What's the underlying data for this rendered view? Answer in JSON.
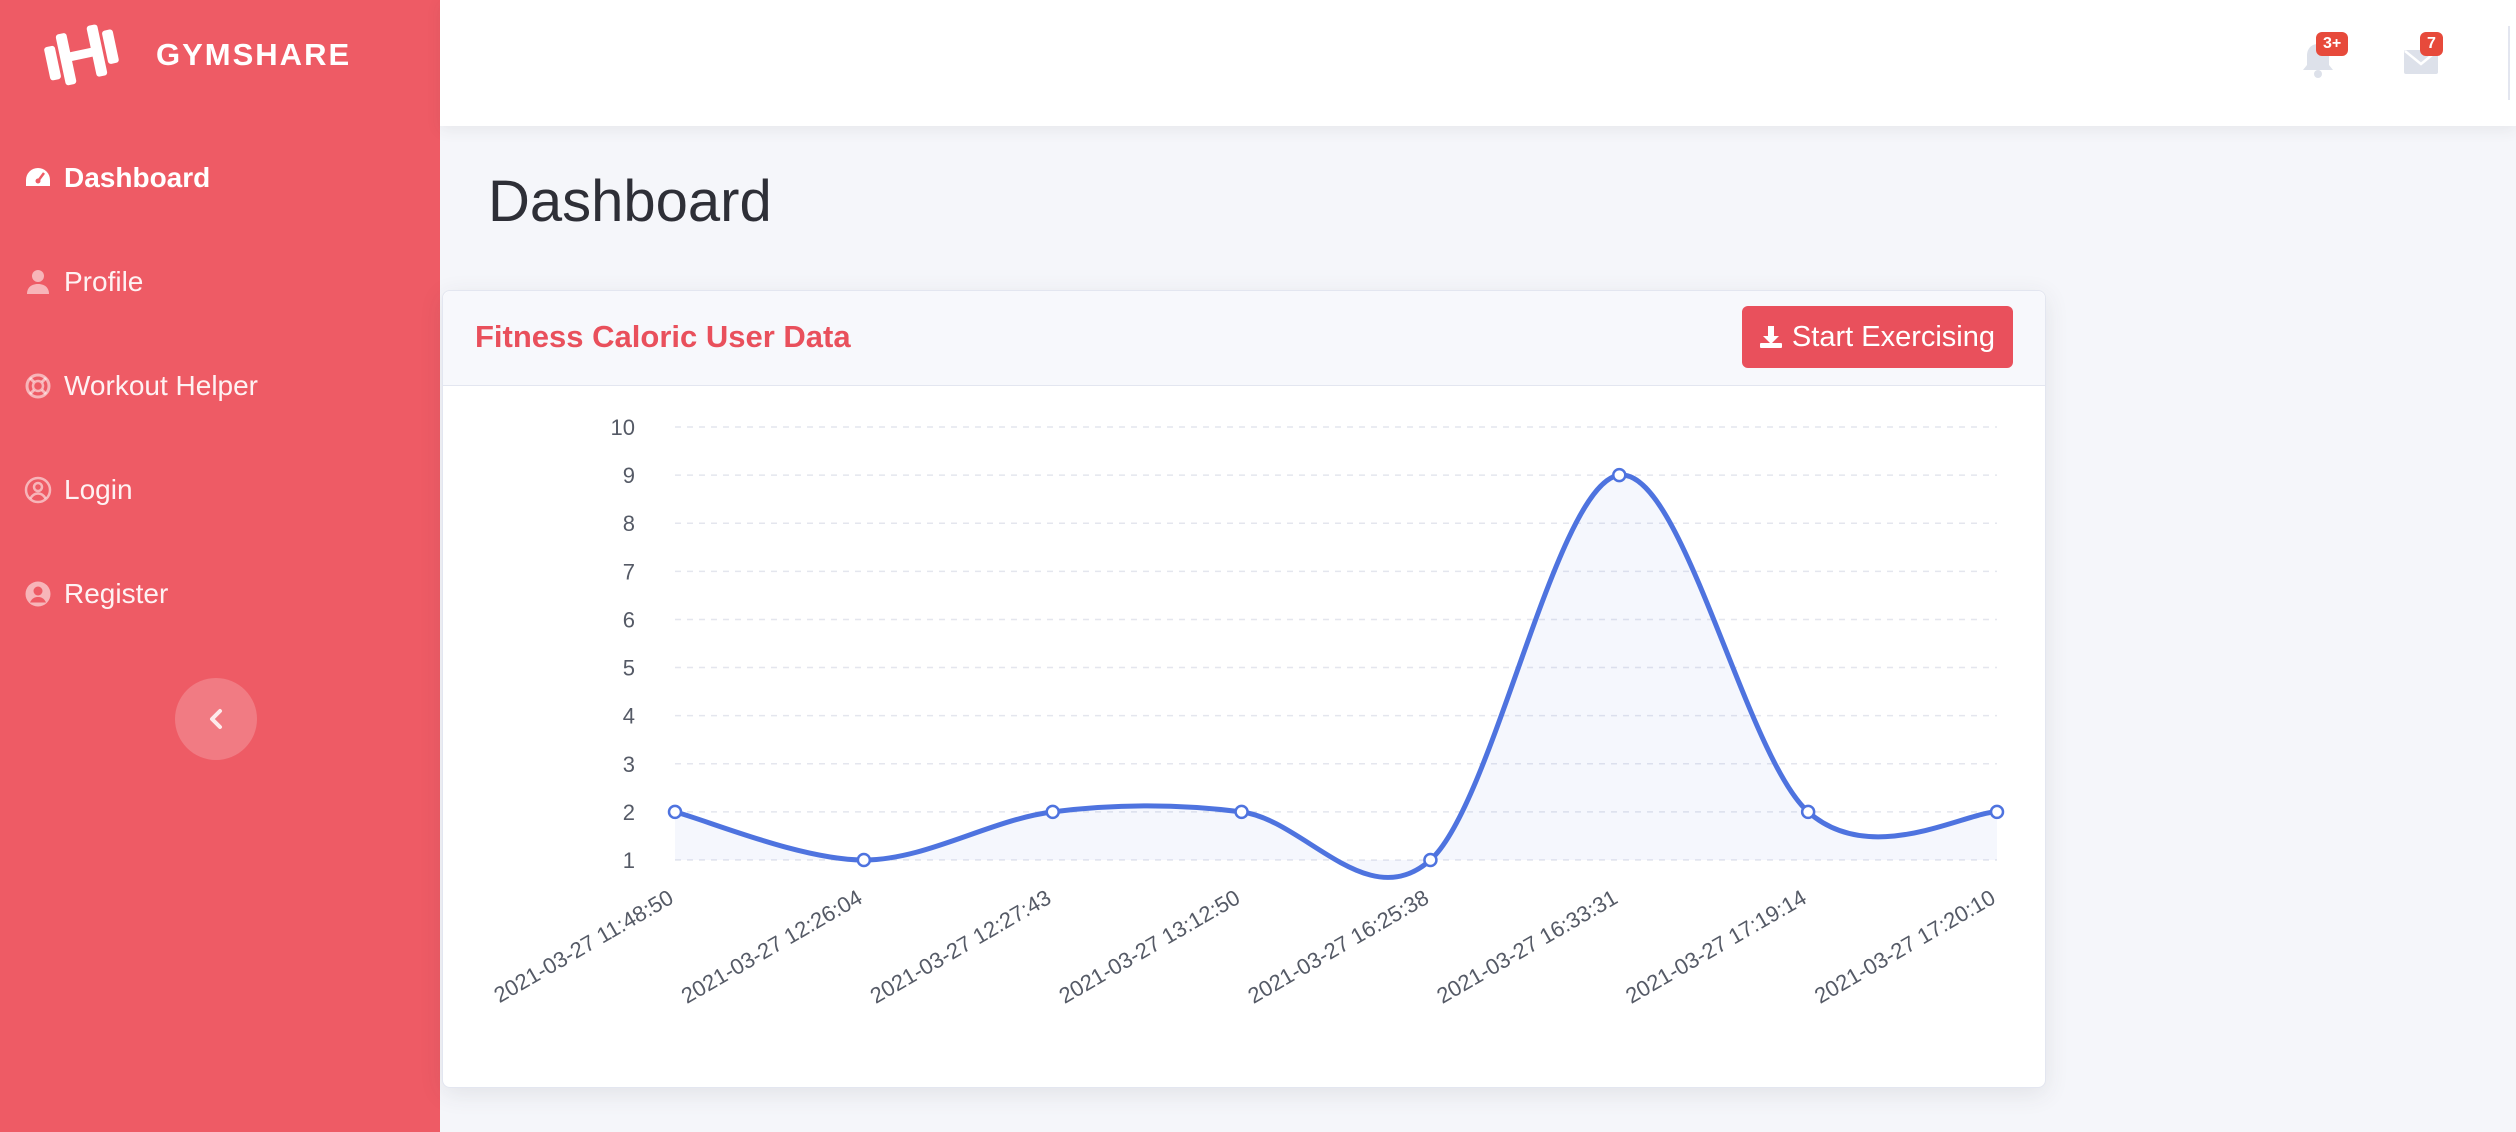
{
  "brand": {
    "name": "GYMSHARE"
  },
  "sidebar": {
    "items": [
      {
        "label": "Dashboard",
        "icon": "tachometer-icon",
        "active": true
      },
      {
        "label": "Profile",
        "icon": "user-icon",
        "active": false
      },
      {
        "label": "Workout Helper",
        "icon": "life-ring-icon",
        "active": false
      },
      {
        "label": "Login",
        "icon": "user-circle-icon",
        "active": false
      },
      {
        "label": "Register",
        "icon": "user-circle-solid-icon",
        "active": false
      }
    ],
    "collapse_icon": "chevron-left-icon"
  },
  "topbar": {
    "alerts": {
      "icon": "bell-icon",
      "badge": "3+"
    },
    "messages": {
      "icon": "envelope-icon",
      "badge": "7"
    }
  },
  "page": {
    "title": "Dashboard"
  },
  "card": {
    "title": "Fitness Caloric User Data",
    "button_label": "Start Exercising",
    "button_icon": "download-icon"
  },
  "colors": {
    "sidebar": "#ee5b65",
    "accent": "#e9505c",
    "line": "#4e73df",
    "badge": "#e74a3b"
  },
  "chart_data": {
    "type": "line",
    "smooth": true,
    "filled": true,
    "grid": true,
    "categories": [
      "2021-03-27 11:48:50",
      "2021-03-27 12:26:04",
      "2021-03-27 12:27:43",
      "2021-03-27 13:12:50",
      "2021-03-27 16:25:38",
      "2021-03-27 16:33:31",
      "2021-03-27 17:19:14",
      "2021-03-27 17:20:10"
    ],
    "values": [
      2,
      1,
      2,
      2,
      1,
      9,
      2,
      2
    ],
    "ylim": [
      1,
      10
    ],
    "yticks": [
      1,
      2,
      3,
      4,
      5,
      6,
      7,
      8,
      9,
      10
    ]
  }
}
